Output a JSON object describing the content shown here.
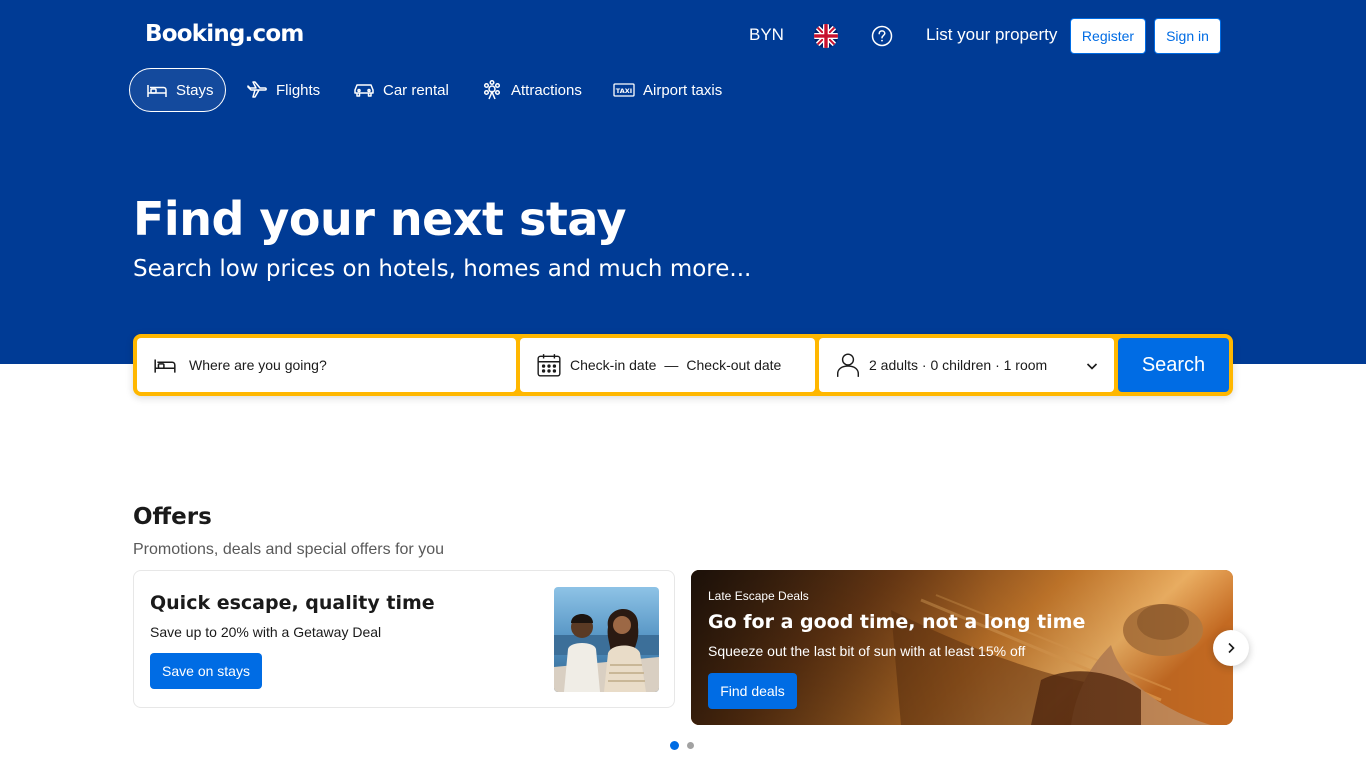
{
  "header": {
    "logo": "Booking.com",
    "currency": "BYN",
    "language_icon": "uk-flag-icon",
    "help_icon": "help-icon",
    "list_property": "List your property",
    "register": "Register",
    "sign_in": "Sign in"
  },
  "nav": {
    "tabs": [
      {
        "label": "Stays",
        "icon": "bed-icon",
        "active": true
      },
      {
        "label": "Flights",
        "icon": "plane-icon",
        "active": false
      },
      {
        "label": "Car rental",
        "icon": "car-icon",
        "active": false
      },
      {
        "label": "Attractions",
        "icon": "attractions-icon",
        "active": false
      },
      {
        "label": "Airport taxis",
        "icon": "taxi-icon",
        "active": false
      }
    ]
  },
  "hero": {
    "title": "Find your next stay",
    "subtitle": "Search low prices on hotels, homes and much more..."
  },
  "search": {
    "destination_placeholder": "Where are you going?",
    "checkin": "Check-in date",
    "separator": "—",
    "checkout": "Check-out date",
    "occupancy": "2 adults · 0 children · 1 room",
    "button": "Search"
  },
  "offers": {
    "title": "Offers",
    "subtitle": "Promotions, deals and special offers for you",
    "cards": [
      {
        "title": "Quick escape, quality time",
        "description": "Save up to 20% with a Getaway Deal",
        "button": "Save on stays"
      },
      {
        "eyebrow": "Late Escape Deals",
        "title": "Go for a good time, not a long time",
        "description": "Squeeze out the last bit of sun with at least 15% off",
        "button": "Find deals"
      }
    ],
    "pagination": {
      "current": 1,
      "total": 2
    }
  },
  "colors": {
    "brand_blue": "#003b95",
    "action_blue": "#006ce4",
    "search_border": "#ffb700"
  }
}
